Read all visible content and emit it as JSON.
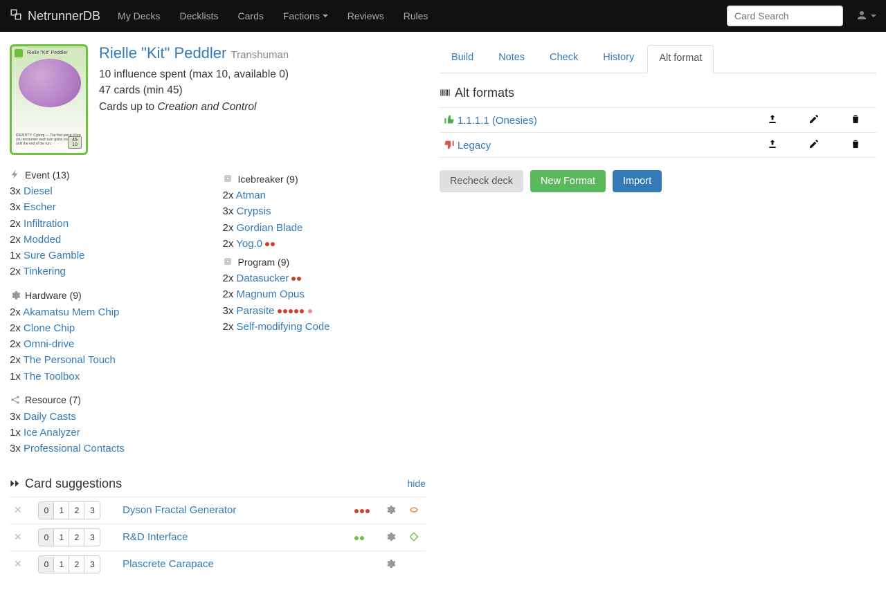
{
  "nav": {
    "brand": "NetrunnerDB",
    "links": [
      "My Decks",
      "Decklists",
      "Cards",
      "Factions",
      "Reviews",
      "Rules"
    ],
    "search_placeholder": "Card Search"
  },
  "identity": {
    "name": "Rielle \"Kit\" Peddler",
    "subtitle": "Transhuman",
    "influence_line": "10 influence spent (max 10, available 0)",
    "cards_line": "47 cards (min 45)",
    "upto_prefix": "Cards up to ",
    "upto_pack": "Creation and Control",
    "card_strip": "Rielle \"Kit\" Peddler",
    "card_body": "IDENTITY: Cyborg — The first piece of ice you encounter each turn gains code gate until the end of the run.",
    "lvl_top": "45",
    "lvl_bot": "10"
  },
  "deck": {
    "left": [
      {
        "heading": "Event (13)",
        "icon": "bolt",
        "cards": [
          {
            "qty": "3x",
            "name": "Diesel"
          },
          {
            "qty": "3x",
            "name": "Escher"
          },
          {
            "qty": "2x",
            "name": "Infiltration"
          },
          {
            "qty": "2x",
            "name": "Modded"
          },
          {
            "qty": "1x",
            "name": "Sure Gamble"
          },
          {
            "qty": "2x",
            "name": "Tinkering"
          }
        ]
      },
      {
        "heading": "Hardware (9)",
        "icon": "gear",
        "cards": [
          {
            "qty": "2x",
            "name": "Akamatsu Mem Chip"
          },
          {
            "qty": "2x",
            "name": "Clone Chip"
          },
          {
            "qty": "2x",
            "name": "Omni-drive"
          },
          {
            "qty": "2x",
            "name": "The Personal Touch"
          },
          {
            "qty": "1x",
            "name": "The Toolbox"
          }
        ]
      },
      {
        "heading": "Resource (7)",
        "icon": "share",
        "cards": [
          {
            "qty": "3x",
            "name": "Daily Casts"
          },
          {
            "qty": "1x",
            "name": "Ice Analyzer"
          },
          {
            "qty": "3x",
            "name": "Professional Contacts"
          }
        ]
      }
    ],
    "right": [
      {
        "heading": "Icebreaker (9)",
        "icon": "chip",
        "cards": [
          {
            "qty": "2x",
            "name": "Atman"
          },
          {
            "qty": "3x",
            "name": "Crypsis"
          },
          {
            "qty": "2x",
            "name": "Gordian Blade"
          },
          {
            "qty": "2x",
            "name": "Yog.0",
            "pips": [
              "red",
              "red"
            ]
          }
        ]
      },
      {
        "heading": "Program (9)",
        "icon": "chip",
        "cards": [
          {
            "qty": "2x",
            "name": "Datasucker",
            "pips": [
              "red",
              "red"
            ]
          },
          {
            "qty": "2x",
            "name": "Magnum Opus"
          },
          {
            "qty": "3x",
            "name": "Parasite",
            "pips": [
              "red",
              "red",
              "red",
              "red",
              "red"
            ],
            "extra_pip": true
          },
          {
            "qty": "2x",
            "name": "Self-modifying Code"
          }
        ]
      }
    ]
  },
  "suggestions": {
    "title": "Card suggestions",
    "hide": "hide",
    "qty_buttons": [
      "0",
      "1",
      "2",
      "3"
    ],
    "rows": [
      {
        "name": "Dyson Fractal Generator",
        "pips": [
          "red",
          "red",
          "red"
        ],
        "type_icon": "gear",
        "faction_icon": "criminal"
      },
      {
        "name": "R&D Interface",
        "pips": [
          "green",
          "green"
        ],
        "type_icon": "gear",
        "faction_icon": "shaper"
      },
      {
        "name": "Plascrete Carapace",
        "pips": [],
        "type_icon": "gear",
        "faction_icon": "none"
      }
    ]
  },
  "right_panel": {
    "tabs": [
      "Build",
      "Notes",
      "Check",
      "History",
      "Alt format"
    ],
    "active_tab": 4,
    "alt_heading": "Alt formats",
    "formats": [
      {
        "name": "1.1.1.1 (Onesies)",
        "status": "up"
      },
      {
        "name": "Legacy",
        "status": "down"
      }
    ],
    "buttons": {
      "recheck": "Recheck deck",
      "new_format": "New Format",
      "import": "Import"
    }
  }
}
